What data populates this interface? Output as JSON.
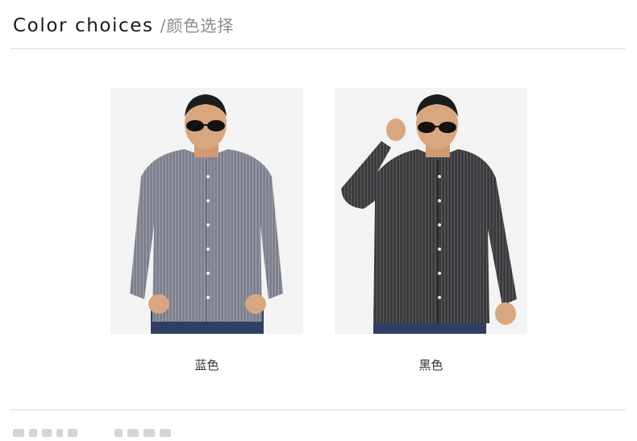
{
  "header": {
    "title_en": "Color choices",
    "title_cn": "/颜色选择"
  },
  "colors": [
    {
      "label": "蓝色",
      "shirt_color": "#7d7f8c",
      "stripe_color": "#9a9ca8"
    },
    {
      "label": "黑色",
      "shirt_color": "#3a3a3c",
      "stripe_color": "#5a5a5e"
    }
  ],
  "palette": {
    "background": "#ffffff",
    "card_bg": "#f3f3f3",
    "divider": "#dcdcdc",
    "jeans": "#2e3f63",
    "skin": "#d9a77f",
    "hair": "#1c1c1c"
  },
  "icons": [
    "sunglasses-icon"
  ]
}
